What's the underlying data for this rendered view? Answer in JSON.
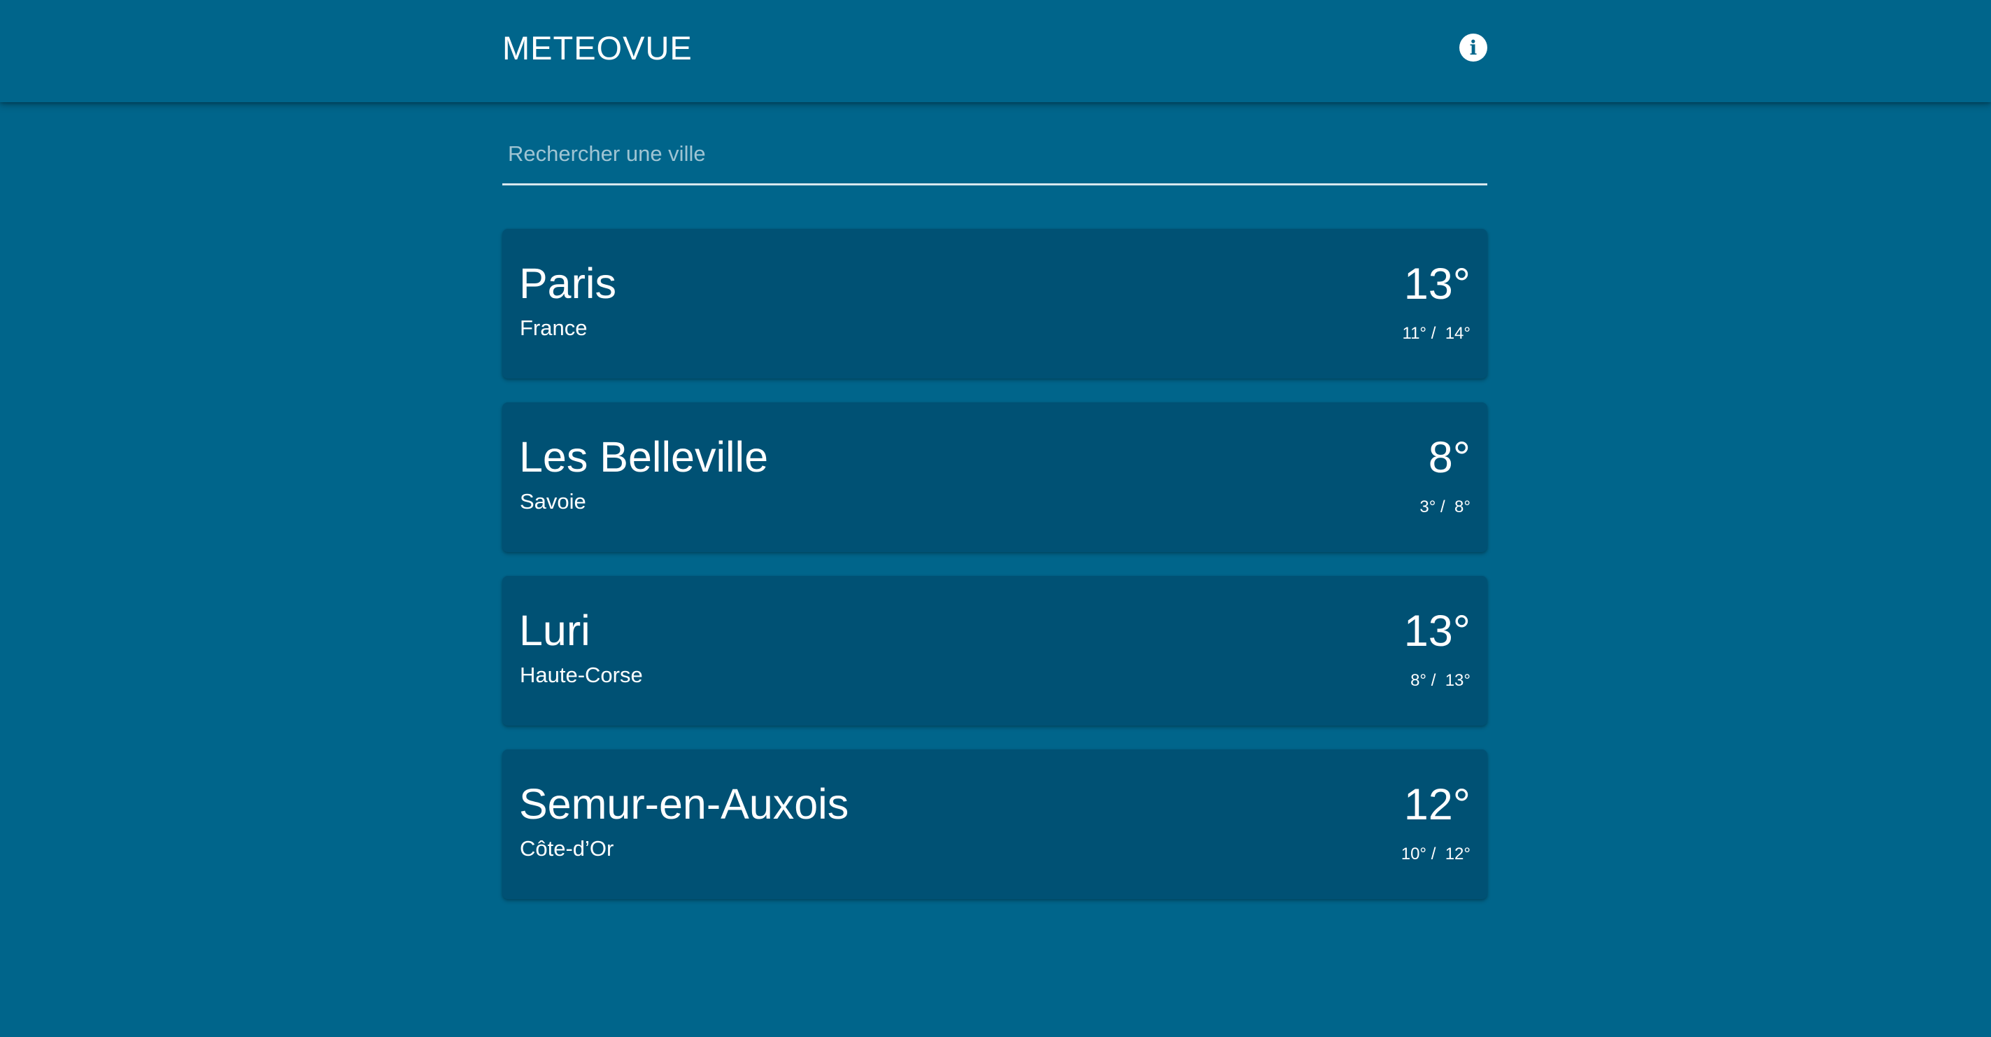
{
  "header": {
    "app_title": "METEOVUE",
    "info_icon": "info-circle-icon"
  },
  "search": {
    "placeholder": "Rechercher une ville",
    "value": ""
  },
  "cities": [
    {
      "name": "Paris",
      "region": "France",
      "temp": "13°",
      "min": "11°",
      "max": "14°"
    },
    {
      "name": "Les Belleville",
      "region": "Savoie",
      "temp": "8°",
      "min": "3°",
      "max": "8°"
    },
    {
      "name": "Luri",
      "region": "Haute-Corse",
      "temp": "13°",
      "min": "8°",
      "max": "13°"
    },
    {
      "name": "Semur-en-Auxois",
      "region": "Côte-d’Or",
      "temp": "12°",
      "min": "10°",
      "max": "12°"
    }
  ],
  "colors": {
    "background": "#00658b",
    "card": "#005174",
    "text": "#ffffff"
  }
}
